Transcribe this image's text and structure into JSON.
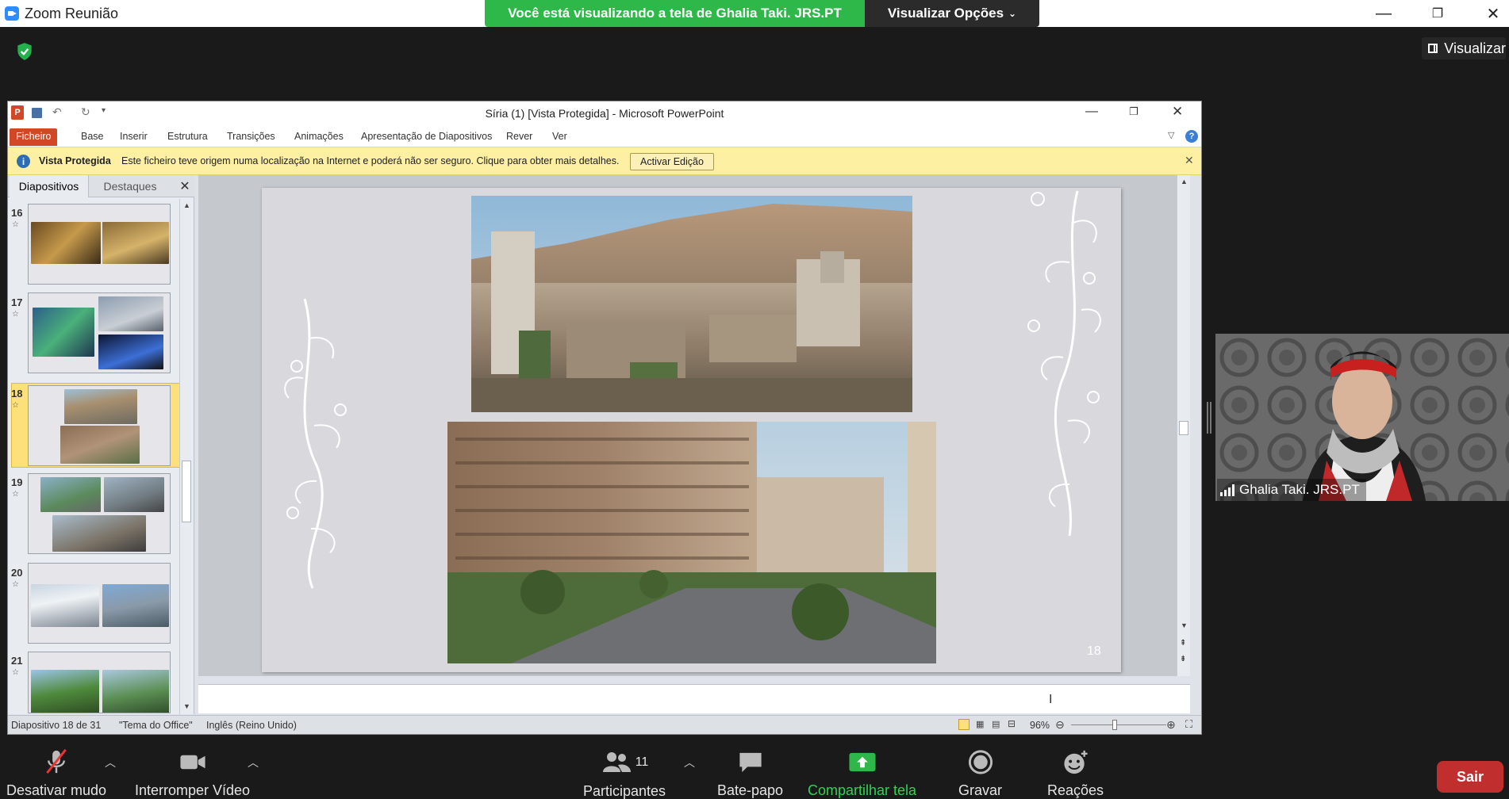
{
  "zoom": {
    "title": "Zoom Reunião",
    "share_banner": "Você está visualizando a tela de Ghalia Taki. JRS.PT",
    "view_options": "Visualizar Opções",
    "visualizar": "Visualizar",
    "participant_name": "Ghalia Taki. JRS.PT",
    "bottom": {
      "mute": "Desativar mudo",
      "video": "Interromper Vídeo",
      "participants": "Participantes",
      "participants_count": "11",
      "chat": "Bate-papo",
      "share": "Compartilhar tela",
      "record": "Gravar",
      "reactions": "Reações",
      "leave": "Sair"
    }
  },
  "ppt": {
    "title": "Síria (1) [Vista Protegida] - Microsoft PowerPoint",
    "tabs": [
      "Ficheiro",
      "Base",
      "Inserir",
      "Estrutura",
      "Transições",
      "Animações",
      "Apresentação de Diapositivos",
      "Rever",
      "Ver"
    ],
    "msgbar": {
      "label": "Vista Protegida",
      "text": "Este ficheiro teve origem numa localização na Internet e poderá não ser seguro. Clique para obter mais detalhes.",
      "button": "Activar Edição"
    },
    "panel_tabs": [
      "Diapositivos",
      "Destaques"
    ],
    "thumbnails": [
      "16",
      "17",
      "18",
      "19",
      "20",
      "21"
    ],
    "slide_number": "18",
    "status": {
      "slide": "Diapositivo 18 de 31",
      "theme": "\"Tema do Office\"",
      "language": "Inglês (Reino Unido)",
      "zoom": "96%"
    }
  },
  "colors": {
    "accent_green": "#2fb84a",
    "ppt_orange": "#d24726",
    "leave_red": "#c12e2e"
  }
}
